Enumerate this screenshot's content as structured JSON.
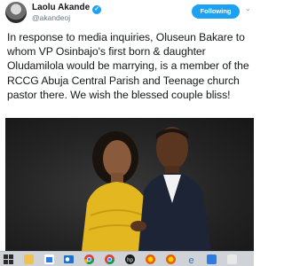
{
  "tweet": {
    "author_name": "Laolu Akande",
    "author_handle": "@akandeoj",
    "follow_label": "Following",
    "text": "In response to media inquiries, Oluseun Bakare to whom VP Osinbajo's first born & daughter Oludamilola would be marrying, is a member of the RCCG Abuja Central Parish and Teenage church pastor there. We wish the blessed couple bliss!"
  },
  "icons": {
    "verified": "verified-badge-icon",
    "more": "chevron-down-icon"
  },
  "colors": {
    "accent": "#1da1f2",
    "text": "#14171a",
    "secondary_text": "#657786",
    "taskbar": "#cfd3d8"
  },
  "taskbar": {
    "apps": [
      "windows-start-icon",
      "file-explorer-icon",
      "store-icon",
      "chrome-icon",
      "outlook-icon",
      "chrome-icon",
      "hp-icon",
      "firefox-icon",
      "firefox-icon",
      "edge-icon",
      "media-icon"
    ]
  }
}
